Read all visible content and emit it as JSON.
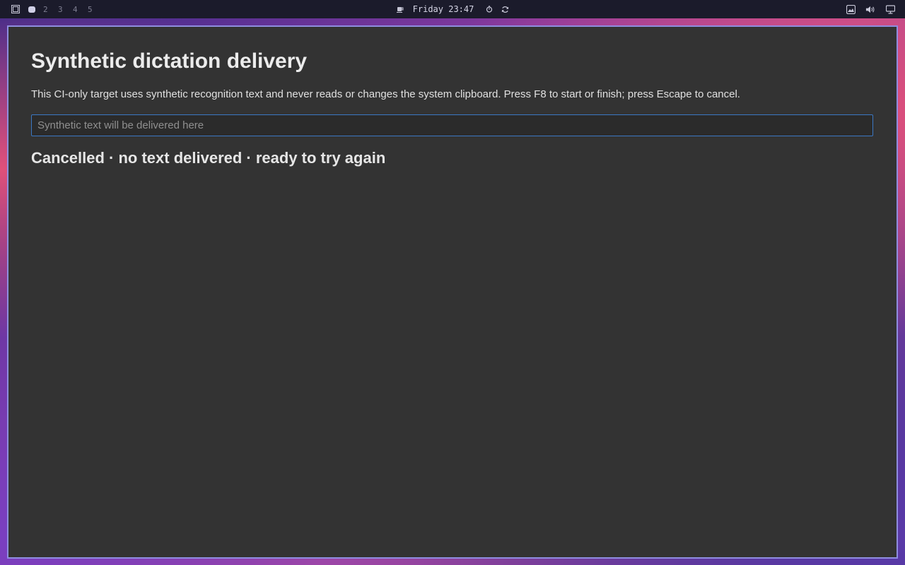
{
  "topbar": {
    "workspaces": [
      "2",
      "3",
      "4",
      "5"
    ],
    "clock": "Friday 23:47",
    "icons": {
      "launcher": "window-frame-icon",
      "active_workspace": "active-workspace-dot",
      "coffee": "coffee-icon",
      "timer": "timer-icon",
      "refresh": "refresh-icon",
      "tray_image": "image-icon",
      "volume": "volume-icon",
      "display": "monitor-icon"
    }
  },
  "window": {
    "title": "Synthetic dictation delivery",
    "description": "This CI-only target uses synthetic recognition text and never reads or changes the system clipboard. Press F8 to start or finish; press Escape to cancel.",
    "input": {
      "value": "",
      "placeholder": "Synthetic text will be delivered here"
    },
    "status": "Cancelled · no text delivered · ready to try again"
  },
  "colors": {
    "window_bg": "#333333",
    "window_border": "#8f8de0",
    "input_border": "#3b78c4",
    "topbar_bg": "#1b1b2b"
  }
}
